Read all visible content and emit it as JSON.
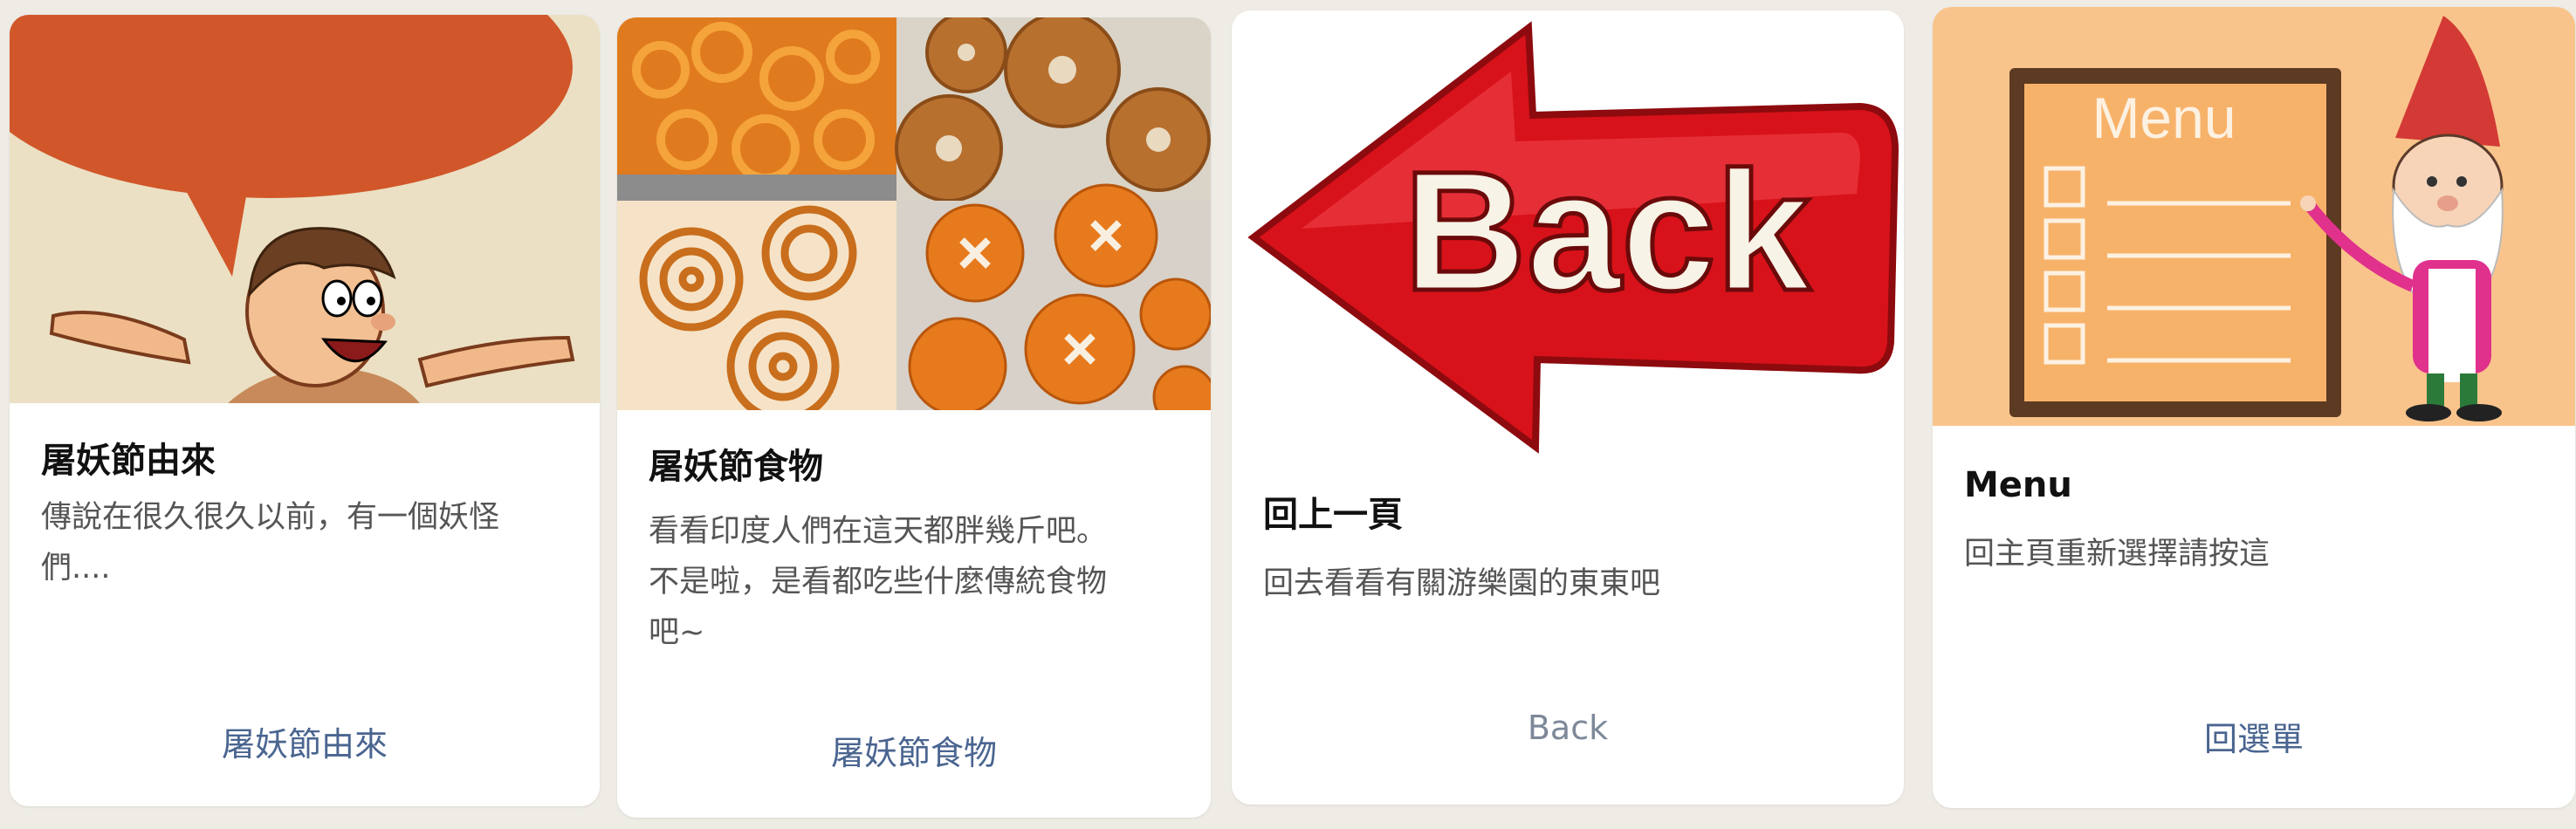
{
  "cards": [
    {
      "title": "屠妖節由來",
      "description": "傳說在很久很久以前，有一個妖怪\n們....",
      "action_label": "屠妖節由來",
      "image": "cartoon-man-speech-bubble"
    },
    {
      "title": "屠妖節食物",
      "description": "看看印度人們在這天都胖幾斤吧。\n不是啦，是看都吃些什麼傳統食物\n吧~",
      "action_label": "屠妖節食物",
      "image": "indian-sweets-collage"
    },
    {
      "title": "回上一頁",
      "description": "回去看看有關游樂園的東東吧",
      "action_label": "Back",
      "image": "red-back-arrow",
      "image_text": "Back"
    },
    {
      "title": "Menu",
      "description": "回主頁重新選擇請按這",
      "action_label": "回選單",
      "image": "chef-with-menu-board",
      "image_text": "Menu"
    }
  ],
  "colors": {
    "link": "#4a6590",
    "link_muted": "#7d8899",
    "background": "#efece6",
    "bubble": "#d1572a",
    "arrow": "#d8121a",
    "menu_bg": "#f9c48b"
  }
}
